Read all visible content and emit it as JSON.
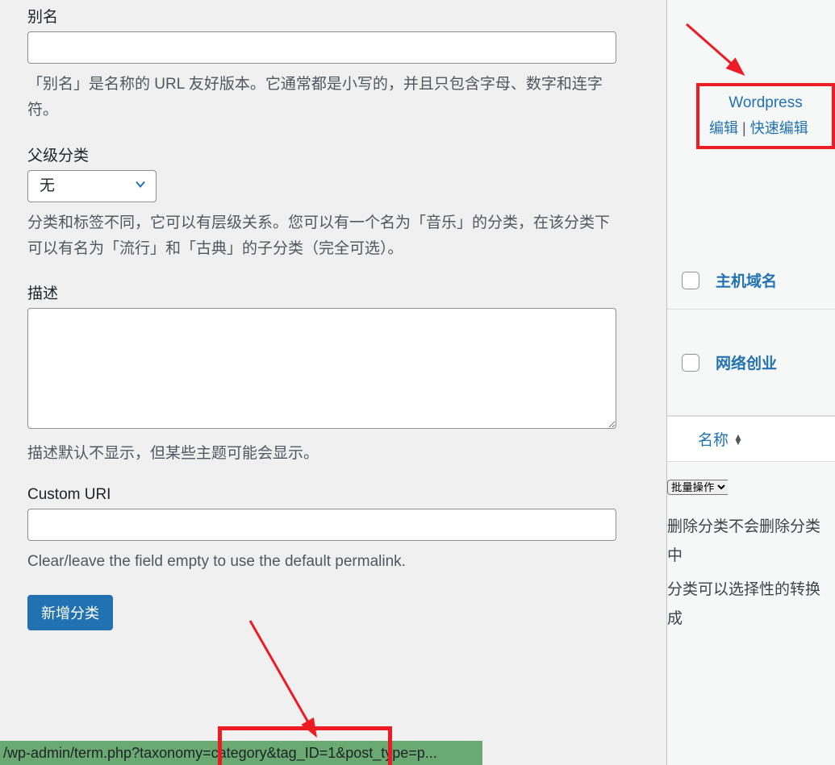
{
  "form": {
    "slug": {
      "label": "别名",
      "value": "",
      "description": "「别名」是名称的 URL 友好版本。它通常都是小写的，并且只包含字母、数字和连字符。"
    },
    "parent": {
      "label": "父级分类",
      "selected": "无",
      "description": "分类和标签不同，它可以有层级关系。您可以有一个名为「音乐」的分类，在该分类下可以有名为「流行」和「古典」的子分类（完全可选）。"
    },
    "description": {
      "label": "描述",
      "value": "",
      "description": "描述默认不显示，但某些主题可能会显示。"
    },
    "custom_uri": {
      "label": "Custom URI",
      "value": "",
      "description": "Clear/leave the field empty to use the default permalink."
    },
    "submit": "新增分类"
  },
  "right": {
    "highlighted": {
      "title": "Wordpress",
      "edit": "编辑",
      "quick_edit": "快速编辑"
    },
    "rows": [
      {
        "name": "主机域名"
      },
      {
        "name": "网络创业"
      }
    ],
    "header_name": "名称",
    "bulk_action": "批量操作",
    "help1": "删除分类不会删除分类中",
    "help2": "分类可以选择性的转换成"
  },
  "status_url": "/wp-admin/term.php?taxonomy=category&tag_ID=1&post_type=p..."
}
